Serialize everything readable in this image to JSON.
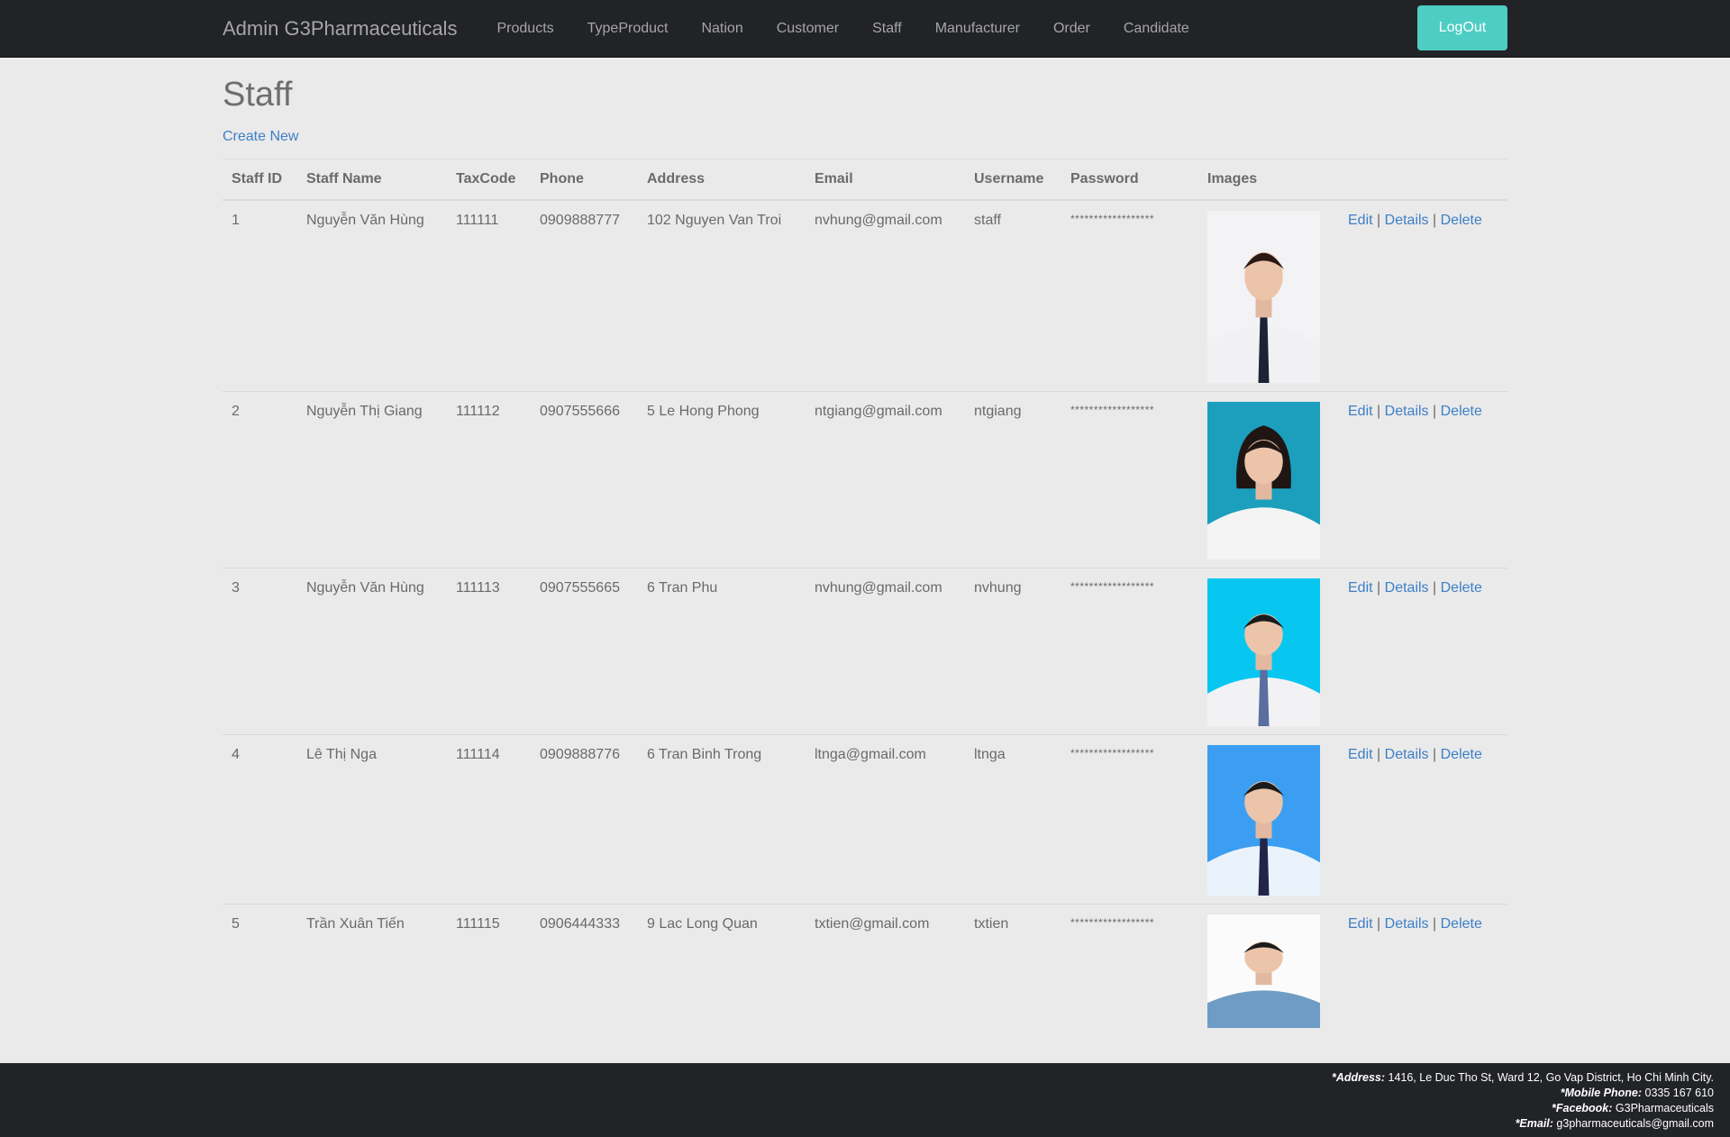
{
  "navbar": {
    "brand": "Admin G3Pharmaceuticals",
    "items": [
      "Products",
      "TypeProduct",
      "Nation",
      "Customer",
      "Staff",
      "Manufacturer",
      "Order",
      "Candidate"
    ],
    "logout_label": "LogOut",
    "logout_color": "#4ecdc4"
  },
  "page": {
    "title": "Staff",
    "create_new": "Create New"
  },
  "table": {
    "headers": [
      "Staff ID",
      "Staff Name",
      "TaxCode",
      "Phone",
      "Address",
      "Email",
      "Username",
      "Password",
      "Images"
    ],
    "actions": {
      "edit": "Edit",
      "details": "Details",
      "delete": "Delete",
      "sep": "|"
    },
    "rows": [
      {
        "id": "1",
        "name": "Nguyễn Văn Hùng",
        "tax": "111111",
        "phone": "0909888777",
        "address": "102 Nguyen Van Troi",
        "email": "nvhung@gmail.com",
        "username": "staff",
        "password": "******************",
        "photo_bg": "#f3f3f6",
        "shirt": "#f1f1f4",
        "tie": "#1d2236",
        "hair": "#2a1815"
      },
      {
        "id": "2",
        "name": "Nguyễn Thị Giang",
        "tax": "111112",
        "phone": "0907555666",
        "address": "5 Le Hong Phong",
        "email": "ntgiang@gmail.com",
        "username": "ntgiang",
        "password": "******************",
        "photo_bg": "#1b9fbd",
        "shirt": "#f4f4f4",
        "tie": "",
        "hair": "#1f1614"
      },
      {
        "id": "3",
        "name": "Nguyễn Văn Hùng",
        "tax": "111113",
        "phone": "0907555665",
        "address": "6 Tran Phu",
        "email": "nvhung@gmail.com",
        "username": "nvhung",
        "password": "******************",
        "photo_bg": "#07c7f0",
        "shirt": "#f2f2f4",
        "tie": "#5a6ea0",
        "hair": "#1b1b1b"
      },
      {
        "id": "4",
        "name": "Lê Thị Nga",
        "tax": "111114",
        "phone": "0909888776",
        "address": "6 Tran Binh Trong",
        "email": "ltnga@gmail.com",
        "username": "ltnga",
        "password": "******************",
        "photo_bg": "#3b9ef2",
        "shirt": "#eaf3fb",
        "tie": "#24244a",
        "hair": "#1b1b1b"
      },
      {
        "id": "5",
        "name": "Trần Xuân Tiến",
        "tax": "111115",
        "phone": "0906444333",
        "address": "9 Lac Long Quan",
        "email": "txtien@gmail.com",
        "username": "txtien",
        "password": "******************",
        "photo_bg": "#fbfbfb",
        "shirt": "#6f9cc4",
        "tie": "",
        "hair": "#1b1b1b"
      }
    ]
  },
  "footer": {
    "address_label": "*Address:",
    "address": " 1416, Le Duc Tho St, Ward 12, Go Vap District, Ho Chi Minh City.",
    "phone_label": "*Mobile Phone:",
    "phone": " 0335 167 610",
    "facebook_label": "*Facebook:",
    "facebook": " G3Pharmaceuticals",
    "email_label": "*Email:",
    "email": " g3pharmaceuticals@gmail.com"
  }
}
